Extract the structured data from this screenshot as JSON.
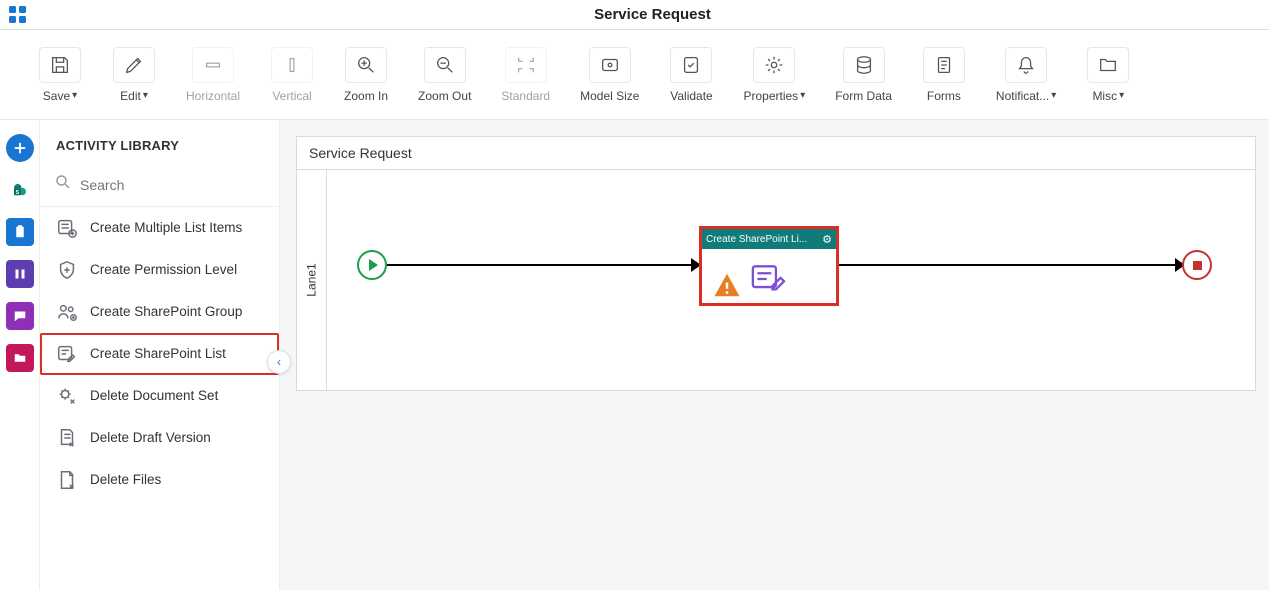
{
  "header": {
    "title": "Service Request"
  },
  "toolbar": {
    "save": "Save",
    "edit": "Edit",
    "horizontal": "Horizontal",
    "vertical": "Vertical",
    "zoom_in": "Zoom In",
    "zoom_out": "Zoom Out",
    "standard": "Standard",
    "model_size": "Model Size",
    "validate": "Validate",
    "properties": "Properties",
    "form_data": "Form Data",
    "forms": "Forms",
    "notifications": "Notificat...",
    "misc": "Misc"
  },
  "library": {
    "title": "ACTIVITY LIBRARY",
    "search_placeholder": "Search",
    "items": {
      "create_multiple_list_items": "Create Multiple List Items",
      "create_permission_level": "Create Permission Level",
      "create_sharepoint_group": "Create SharePoint Group",
      "create_sharepoint_list": "Create SharePoint List",
      "delete_document_set": "Delete Document Set",
      "delete_draft_version": "Delete Draft Version",
      "delete_files": "Delete Files"
    }
  },
  "canvas": {
    "title": "Service Request",
    "lane": "Lane1",
    "activity_title": "Create SharePoint Li..."
  }
}
